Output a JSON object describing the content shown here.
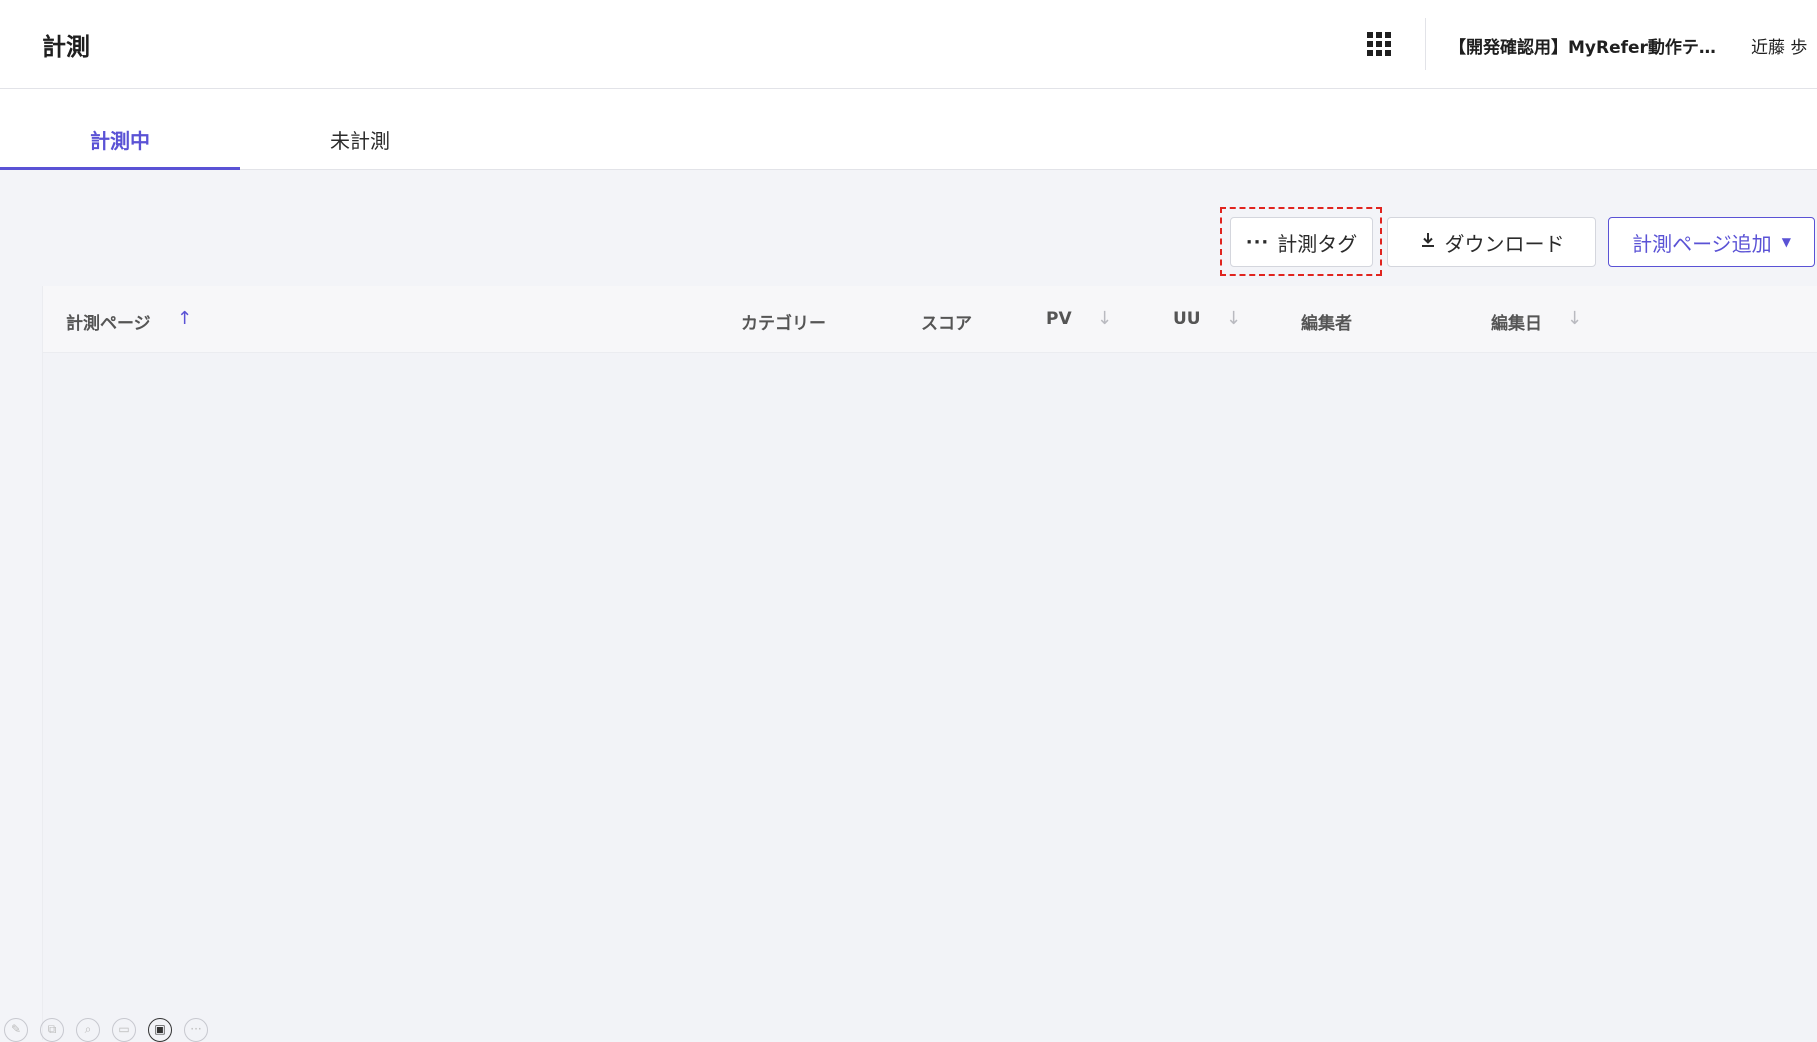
{
  "header": {
    "title": "計測",
    "project": "【開発確認用】MyRefer動作テ…",
    "user": "近藤 歩"
  },
  "tabs": [
    {
      "label": "計測中",
      "active": true
    },
    {
      "label": "未計測",
      "active": false
    }
  ],
  "toolbar": {
    "tag_button": "計測タグ",
    "download_button": "ダウンロード",
    "add_button": "計測ページ追加"
  },
  "table": {
    "columns": [
      "計測ページ",
      "カテゴリー",
      "スコア",
      "PV",
      "UU",
      "編集者",
      "編集日"
    ],
    "rows": []
  },
  "colors": {
    "accent": "#5a52d5",
    "highlight": "#e0241f"
  }
}
